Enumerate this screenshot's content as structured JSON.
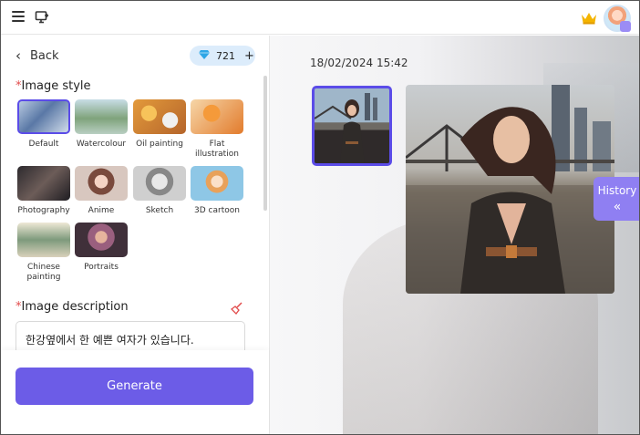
{
  "topbar": {
    "menu_icon": "hamburger-menu-icon",
    "screen_icon": "monitor-icon",
    "crown_icon": "crown-icon",
    "avatar_icon": "user-avatar-icon"
  },
  "left": {
    "back_label": "Back",
    "gems_count": "721",
    "gems_plus": "+",
    "image_style": {
      "required_mark": "*",
      "title": "Image style",
      "items": [
        {
          "label": "Default",
          "selected": true
        },
        {
          "label": "Watercolour",
          "selected": false
        },
        {
          "label": "Oil painting",
          "selected": false
        },
        {
          "label": "Flat illustration",
          "selected": false
        },
        {
          "label": "Photography",
          "selected": false
        },
        {
          "label": "Anime",
          "selected": false
        },
        {
          "label": "Sketch",
          "selected": false
        },
        {
          "label": "3D cartoon",
          "selected": false
        },
        {
          "label": "Chinese painting",
          "selected": false
        },
        {
          "label": "Portraits",
          "selected": false
        }
      ]
    },
    "image_description": {
      "required_mark": "*",
      "title": "Image description",
      "value": "한강옆에서 한 예쁜 여자가 있습니다."
    },
    "generate_label": "Generate"
  },
  "right": {
    "datetime": "18/02/2024 15:42",
    "history_label": "History",
    "history_arrows": "«"
  },
  "colors": {
    "accent": "#6c5ce7",
    "selected_border": "#5b4ce8",
    "history_bg": "#8f7ff2",
    "required": "#e24c4c",
    "gems_bg": "#dcecfb"
  }
}
